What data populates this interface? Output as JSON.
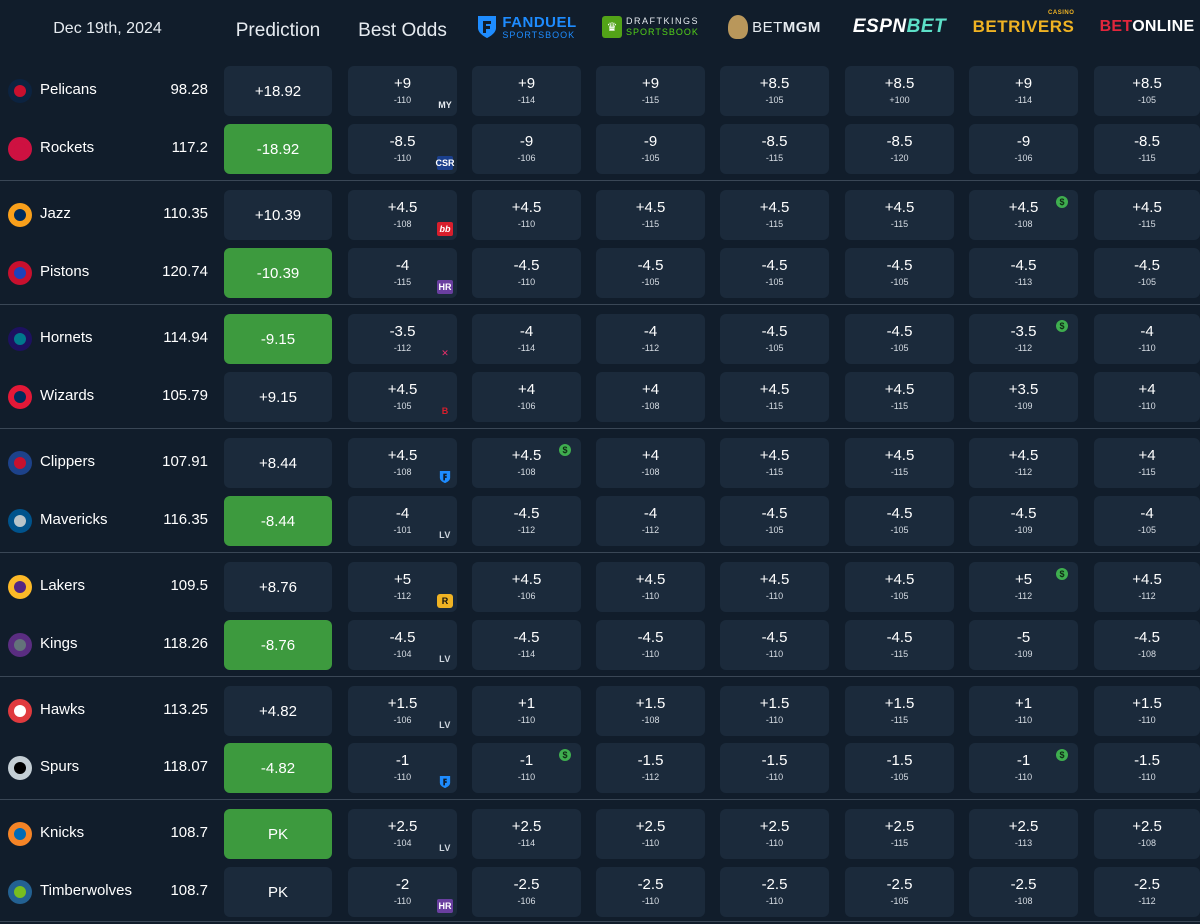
{
  "header": {
    "date": "Dec 19th, 2024",
    "prediction_label": "Prediction",
    "best_odds_label": "Best Odds",
    "books": [
      {
        "key": "fanduel",
        "word1": "FANDUEL",
        "word2": "SPORTSBOOK",
        "color": "#1e8cff"
      },
      {
        "key": "draftkings",
        "word1": "DRAFTKINGS",
        "word2": "SPORTSBOOK",
        "color": "#53d118"
      },
      {
        "key": "betmgm",
        "word1": "BET",
        "word2": "MGM",
        "color": "#b9975b"
      },
      {
        "key": "espnbet",
        "word1": "ESPN",
        "word2": "BET",
        "color": "#5de0c8"
      },
      {
        "key": "betrivers",
        "word1": "BETRIVERS",
        "word2": "CASINO",
        "color": "#f0b323"
      },
      {
        "key": "betonline",
        "word1": "BET",
        "word2": "ONLINE",
        "color": "#e2263c"
      }
    ]
  },
  "colors": {
    "background": "#111d2b",
    "cell": "#1b2a3b",
    "prediction_win": "#3d9a3e",
    "best_price_badge": "#3fae4f"
  },
  "games": [
    {
      "teams": [
        {
          "name": "Pelicans",
          "icon": "pelicans-logo-icon",
          "score": "98.28",
          "prediction": "+18.92",
          "win": false,
          "best": {
            "line": "+9",
            "odds": "-110",
            "book": "MY"
          },
          "odds": [
            {
              "line": "+9",
              "odds": "-114"
            },
            {
              "line": "+9",
              "odds": "-115"
            },
            {
              "line": "+8.5",
              "odds": "-105"
            },
            {
              "line": "+8.5",
              "odds": "+100"
            },
            {
              "line": "+9",
              "odds": "-114"
            },
            {
              "line": "+8.5",
              "odds": "-105"
            }
          ]
        },
        {
          "name": "Rockets",
          "icon": "rockets-logo-icon",
          "score": "117.2",
          "prediction": "-18.92",
          "win": true,
          "best": {
            "line": "-8.5",
            "odds": "-110",
            "book": "CSR"
          },
          "odds": [
            {
              "line": "-9",
              "odds": "-106"
            },
            {
              "line": "-9",
              "odds": "-105"
            },
            {
              "line": "-8.5",
              "odds": "-115"
            },
            {
              "line": "-8.5",
              "odds": "-120"
            },
            {
              "line": "-9",
              "odds": "-106"
            },
            {
              "line": "-8.5",
              "odds": "-115"
            }
          ]
        }
      ]
    },
    {
      "teams": [
        {
          "name": "Jazz",
          "icon": "jazz-logo-icon",
          "score": "110.35",
          "prediction": "+10.39",
          "win": false,
          "best": {
            "line": "+4.5",
            "odds": "-108",
            "book": "BB"
          },
          "odds": [
            {
              "line": "+4.5",
              "odds": "-110"
            },
            {
              "line": "+4.5",
              "odds": "-115"
            },
            {
              "line": "+4.5",
              "odds": "-115"
            },
            {
              "line": "+4.5",
              "odds": "-115"
            },
            {
              "line": "+4.5",
              "odds": "-108",
              "badge": "$"
            },
            {
              "line": "+4.5",
              "odds": "-115"
            }
          ]
        },
        {
          "name": "Pistons",
          "icon": "pistons-logo-icon",
          "score": "120.74",
          "prediction": "-10.39",
          "win": true,
          "best": {
            "line": "-4",
            "odds": "-115",
            "book": "HR"
          },
          "odds": [
            {
              "line": "-4.5",
              "odds": "-110"
            },
            {
              "line": "-4.5",
              "odds": "-105"
            },
            {
              "line": "-4.5",
              "odds": "-105"
            },
            {
              "line": "-4.5",
              "odds": "-105"
            },
            {
              "line": "-4.5",
              "odds": "-113"
            },
            {
              "line": "-4.5",
              "odds": "-105"
            }
          ]
        }
      ]
    },
    {
      "teams": [
        {
          "name": "Hornets",
          "icon": "hornets-logo-icon",
          "score": "114.94",
          "prediction": "-9.15",
          "win": true,
          "best": {
            "line": "-3.5",
            "odds": "-112",
            "book": "X"
          },
          "odds": [
            {
              "line": "-4",
              "odds": "-114"
            },
            {
              "line": "-4",
              "odds": "-112"
            },
            {
              "line": "-4.5",
              "odds": "-105"
            },
            {
              "line": "-4.5",
              "odds": "-105"
            },
            {
              "line": "-3.5",
              "odds": "-112",
              "badge": "$"
            },
            {
              "line": "-4",
              "odds": "-110"
            }
          ]
        },
        {
          "name": "Wizards",
          "icon": "wizards-logo-icon",
          "score": "105.79",
          "prediction": "+9.15",
          "win": false,
          "best": {
            "line": "+4.5",
            "odds": "-105",
            "book": "B"
          },
          "odds": [
            {
              "line": "+4",
              "odds": "-106"
            },
            {
              "line": "+4",
              "odds": "-108"
            },
            {
              "line": "+4.5",
              "odds": "-115"
            },
            {
              "line": "+4.5",
              "odds": "-115"
            },
            {
              "line": "+3.5",
              "odds": "-109"
            },
            {
              "line": "+4",
              "odds": "-110"
            }
          ]
        }
      ]
    },
    {
      "teams": [
        {
          "name": "Clippers",
          "icon": "clippers-logo-icon",
          "score": "107.91",
          "prediction": "+8.44",
          "win": false,
          "best": {
            "line": "+4.5",
            "odds": "-108",
            "book": "FD"
          },
          "odds": [
            {
              "line": "+4.5",
              "odds": "-108",
              "badge": "$"
            },
            {
              "line": "+4",
              "odds": "-108"
            },
            {
              "line": "+4.5",
              "odds": "-115"
            },
            {
              "line": "+4.5",
              "odds": "-115"
            },
            {
              "line": "+4.5",
              "odds": "-112"
            },
            {
              "line": "+4",
              "odds": "-115"
            }
          ]
        },
        {
          "name": "Mavericks",
          "icon": "mavericks-logo-icon",
          "score": "116.35",
          "prediction": "-8.44",
          "win": true,
          "best": {
            "line": "-4",
            "odds": "-101",
            "book": "LV"
          },
          "odds": [
            {
              "line": "-4.5",
              "odds": "-112"
            },
            {
              "line": "-4",
              "odds": "-112"
            },
            {
              "line": "-4.5",
              "odds": "-105"
            },
            {
              "line": "-4.5",
              "odds": "-105"
            },
            {
              "line": "-4.5",
              "odds": "-109"
            },
            {
              "line": "-4",
              "odds": "-105"
            }
          ]
        }
      ]
    },
    {
      "teams": [
        {
          "name": "Lakers",
          "icon": "lakers-logo-icon",
          "score": "109.5",
          "prediction": "+8.76",
          "win": false,
          "best": {
            "line": "+5",
            "odds": "-112",
            "book": "R"
          },
          "odds": [
            {
              "line": "+4.5",
              "odds": "-106"
            },
            {
              "line": "+4.5",
              "odds": "-110"
            },
            {
              "line": "+4.5",
              "odds": "-110"
            },
            {
              "line": "+4.5",
              "odds": "-105"
            },
            {
              "line": "+5",
              "odds": "-112",
              "badge": "$"
            },
            {
              "line": "+4.5",
              "odds": "-112"
            }
          ]
        },
        {
          "name": "Kings",
          "icon": "kings-logo-icon",
          "score": "118.26",
          "prediction": "-8.76",
          "win": true,
          "best": {
            "line": "-4.5",
            "odds": "-104",
            "book": "LV"
          },
          "odds": [
            {
              "line": "-4.5",
              "odds": "-114"
            },
            {
              "line": "-4.5",
              "odds": "-110"
            },
            {
              "line": "-4.5",
              "odds": "-110"
            },
            {
              "line": "-4.5",
              "odds": "-115"
            },
            {
              "line": "-5",
              "odds": "-109"
            },
            {
              "line": "-4.5",
              "odds": "-108"
            }
          ]
        }
      ]
    },
    {
      "teams": [
        {
          "name": "Hawks",
          "icon": "hawks-logo-icon",
          "score": "113.25",
          "prediction": "+4.82",
          "win": false,
          "best": {
            "line": "+1.5",
            "odds": "-106",
            "book": "LV"
          },
          "odds": [
            {
              "line": "+1",
              "odds": "-110"
            },
            {
              "line": "+1.5",
              "odds": "-108"
            },
            {
              "line": "+1.5",
              "odds": "-110"
            },
            {
              "line": "+1.5",
              "odds": "-115"
            },
            {
              "line": "+1",
              "odds": "-110"
            },
            {
              "line": "+1.5",
              "odds": "-110"
            }
          ]
        },
        {
          "name": "Spurs",
          "icon": "spurs-logo-icon",
          "score": "118.07",
          "prediction": "-4.82",
          "win": true,
          "best": {
            "line": "-1",
            "odds": "-110",
            "book": "FD"
          },
          "odds": [
            {
              "line": "-1",
              "odds": "-110",
              "badge": "$"
            },
            {
              "line": "-1.5",
              "odds": "-112"
            },
            {
              "line": "-1.5",
              "odds": "-110"
            },
            {
              "line": "-1.5",
              "odds": "-105"
            },
            {
              "line": "-1",
              "odds": "-110",
              "badge": "$"
            },
            {
              "line": "-1.5",
              "odds": "-110"
            }
          ]
        }
      ]
    },
    {
      "teams": [
        {
          "name": "Knicks",
          "icon": "knicks-logo-icon",
          "score": "108.7",
          "prediction": "PK",
          "win": true,
          "best": {
            "line": "+2.5",
            "odds": "-104",
            "book": "LV"
          },
          "odds": [
            {
              "line": "+2.5",
              "odds": "-114"
            },
            {
              "line": "+2.5",
              "odds": "-110"
            },
            {
              "line": "+2.5",
              "odds": "-110"
            },
            {
              "line": "+2.5",
              "odds": "-115"
            },
            {
              "line": "+2.5",
              "odds": "-113"
            },
            {
              "line": "+2.5",
              "odds": "-108"
            }
          ]
        },
        {
          "name": "Timberwolves",
          "icon": "timberwolves-logo-icon",
          "score": "108.7",
          "prediction": "PK",
          "win": false,
          "best": {
            "line": "-2",
            "odds": "-110",
            "book": "HR"
          },
          "odds": [
            {
              "line": "-2.5",
              "odds": "-106"
            },
            {
              "line": "-2.5",
              "odds": "-110"
            },
            {
              "line": "-2.5",
              "odds": "-110"
            },
            {
              "line": "-2.5",
              "odds": "-105"
            },
            {
              "line": "-2.5",
              "odds": "-108"
            },
            {
              "line": "-2.5",
              "odds": "-112"
            }
          ]
        }
      ]
    }
  ]
}
